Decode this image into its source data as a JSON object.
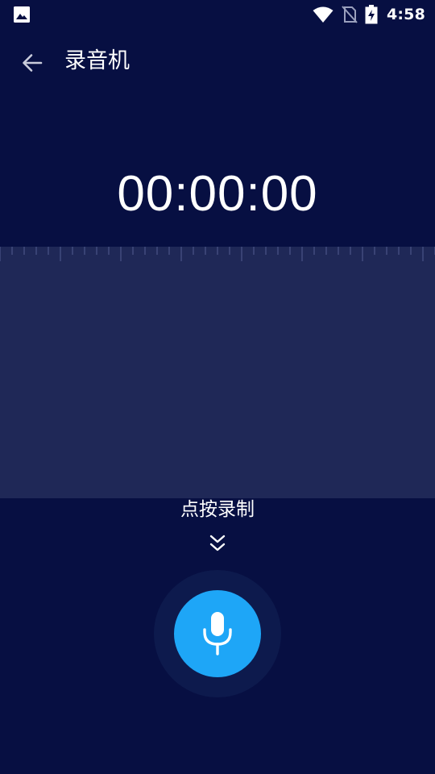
{
  "status_bar": {
    "time": "4:58",
    "icons": [
      "gallery-icon",
      "wifi-icon",
      "no-sim-icon",
      "battery-charging-icon"
    ]
  },
  "app_bar": {
    "title": "录音机",
    "back_icon": "arrow-left-icon"
  },
  "recorder": {
    "elapsed": "00:00:00",
    "hint": "点按录制",
    "hint_icon": "chevron-double-down-icon",
    "button_icon": "microphone-icon"
  },
  "colors": {
    "background": "#070f42",
    "waveform_panel": "#1f2857",
    "accent": "#1ea6f7",
    "button_ring": "#0d1a4d"
  }
}
